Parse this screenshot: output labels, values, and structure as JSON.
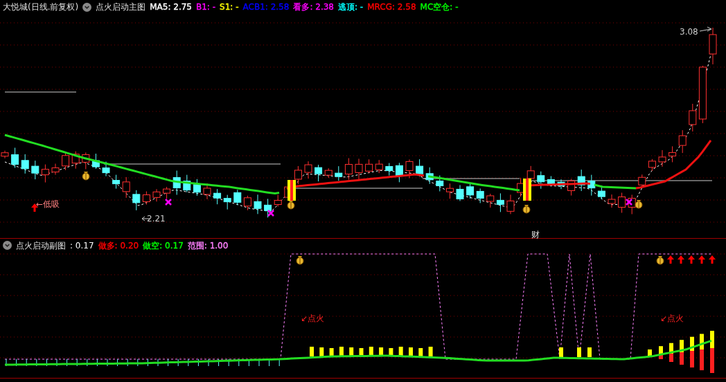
{
  "main_chart": {
    "title": "大悦城(日线.前复权)",
    "indicator": "点火启动主图",
    "legend": [
      {
        "label": "MA5:",
        "value": "2.75",
        "color": "#ffffff"
      },
      {
        "label": "B1:",
        "value": "-",
        "color": "#ff00ff"
      },
      {
        "label": "S1:",
        "value": "-",
        "color": "#ffff00"
      },
      {
        "label": "ACB1:",
        "value": "2.58",
        "color": "#0000ff"
      },
      {
        "label": "看多:",
        "value": "2.38",
        "color": "#ff00ff"
      },
      {
        "label": "逃顶:",
        "value": "-",
        "color": "#00ffff"
      },
      {
        "label": "MRCG:",
        "value": "2.58",
        "color": "#ff0000"
      },
      {
        "label": "MC空仓:",
        "value": "-",
        "color": "#00ff00"
      }
    ],
    "high_label": "3.08",
    "low_label": "2.21",
    "buy_label": "←低吸",
    "mark_label": "财"
  },
  "sub_chart": {
    "indicator": "点火启动副图",
    "value": ": 0.17",
    "legend": [
      {
        "label": "做多:",
        "value": "0.20",
        "color": "#ff0000"
      },
      {
        "label": "做空:",
        "value": "0.17",
        "color": "#00ff00"
      },
      {
        "label": "范围:",
        "value": "1.00",
        "color": "#ff80ff"
      }
    ],
    "signal_labels": [
      "↙点火",
      "↙点火"
    ]
  }
}
